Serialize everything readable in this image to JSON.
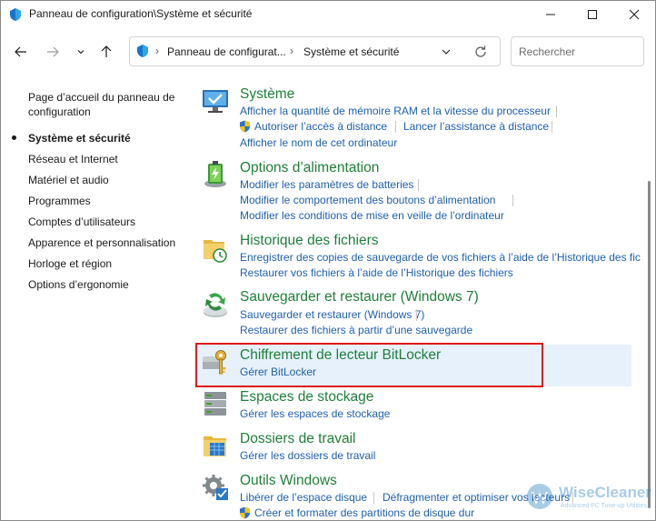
{
  "window": {
    "title": "Panneau de configuration\\Système et sécurité"
  },
  "nav": {
    "back_icon": "arrow-left-icon",
    "forward_icon": "arrow-right-icon",
    "recent_icon": "chevron-down-icon",
    "up_icon": "arrow-up-icon"
  },
  "address": {
    "crumbs": [
      "Panneau de configurat...",
      "Système et sécurité"
    ]
  },
  "search": {
    "placeholder": "Rechercher"
  },
  "sidebar": {
    "items": [
      {
        "label": "Page d’accueil du panneau de",
        "label2": "configuration"
      },
      {
        "label": "Système et sécurité",
        "current": true
      },
      {
        "label": "Réseau et Internet"
      },
      {
        "label": "Matériel et audio"
      },
      {
        "label": "Programmes"
      },
      {
        "label": "Comptes d’utilisateurs"
      },
      {
        "label": "Apparence et personnalisation"
      },
      {
        "label": "Horloge et région"
      },
      {
        "label": "Options d’ergonomie"
      }
    ]
  },
  "categories": [
    {
      "title": "Système",
      "icon": "monitor-check-icon",
      "links": [
        "Afficher la quantité de mémoire RAM et la vitesse du processeur",
        "Autoriser l’accès à distance",
        "Lancer l’assistance à distance",
        "Afficher le nom de cet ordinateur"
      ]
    },
    {
      "title": "Options d’alimentation",
      "icon": "battery-icon",
      "links": [
        "Modifier les paramètres de batteries",
        "Modifier le comportement des boutons d’alimentation",
        "Modifier les conditions de mise en veille de l’ordinateur"
      ]
    },
    {
      "title": "Historique des fichiers",
      "icon": "file-history-icon",
      "links": [
        "Enregistrer des copies de sauvegarde de vos fichiers à l’aide de l’Historique des fic",
        "Restaurer vos fichiers à l’aide de l’Historique des fichiers"
      ]
    },
    {
      "title": "Sauvegarder et restaurer (Windows 7)",
      "icon": "backup-restore-icon",
      "links": [
        "Sauvegarder et restaurer (Windows 7)",
        "Restaurer des fichiers à partir d’une sauvegarde"
      ]
    },
    {
      "title": "Chiffrement de lecteur BitLocker",
      "icon": "bitlocker-key-icon",
      "links": [
        "Gérer BitLocker"
      ]
    },
    {
      "title": "Espaces de stockage",
      "icon": "storage-spaces-icon",
      "links": [
        "Gérer les espaces de stockage"
      ]
    },
    {
      "title": "Dossiers de travail",
      "icon": "work-folders-icon",
      "links": [
        "Gérer les dossiers de travail"
      ]
    },
    {
      "title": "Outils Windows",
      "icon": "windows-tools-icon",
      "links": [
        "Libérer de l’espace disque",
        "Défragmenter et optimiser vos lecteurs",
        "Créer et formater des partitions de disque dur"
      ]
    }
  ],
  "watermark": {
    "name": "WiseCleaner",
    "tagline": "Advanced PC Tune-up Utilities"
  },
  "colors": {
    "category_title": "#1e7f3a",
    "link": "#1f5fb0",
    "highlight": "#e6f1fb",
    "annotation_box": "#e01818"
  }
}
